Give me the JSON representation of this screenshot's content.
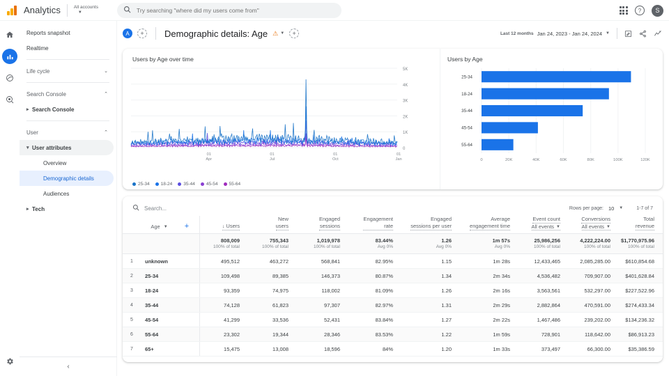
{
  "topbar": {
    "brand": "Analytics",
    "account_label": "All accounts",
    "search_placeholder": "Try searching \"where did my users come from\"",
    "search_value": "",
    "avatar_initial": "S"
  },
  "rail": {
    "items": [
      {
        "name": "home-icon",
        "label": "Home"
      },
      {
        "name": "reports-icon",
        "label": "Reports"
      },
      {
        "name": "explore-icon",
        "label": "Explore"
      },
      {
        "name": "advertising-icon",
        "label": "Advertising"
      }
    ],
    "settings_label": "Admin"
  },
  "sidebar": {
    "items": [
      {
        "label": "Reports snapshot",
        "type": "plain"
      },
      {
        "label": "Realtime",
        "type": "plain"
      },
      {
        "label": "Life cycle",
        "type": "group",
        "chevron": "⌄"
      },
      {
        "label": "Search Console",
        "type": "group",
        "chevron": "⌃"
      },
      {
        "label": "Search Console",
        "type": "sub"
      },
      {
        "label": "User",
        "type": "group",
        "chevron": "⌃"
      },
      {
        "label": "User attributes",
        "type": "sub-active"
      },
      {
        "label": "Overview",
        "type": "leaf"
      },
      {
        "label": "Demographic details",
        "type": "leaf-selected"
      },
      {
        "label": "Audiences",
        "type": "leaf"
      },
      {
        "label": "Tech",
        "type": "sub"
      }
    ],
    "collapse_label": "‹"
  },
  "header": {
    "chip_initial": "A",
    "add_comparison_label": "+",
    "title": "Demographic details: Age",
    "warning_label": "⚠",
    "add_label": "+",
    "date_preset": "Last 12 months",
    "date_range": "Jan 24, 2023 - Jan 24, 2024",
    "actions": [
      "edit-icon",
      "share-icon",
      "insights-icon"
    ]
  },
  "chart_data": [
    {
      "type": "line",
      "title": "Users by Age over time",
      "xlabel": "",
      "ylabel": "",
      "ylim": [
        0,
        5000
      ],
      "yticks": [
        "0",
        "1K",
        "2K",
        "3K",
        "4K",
        "5K"
      ],
      "xticks": [
        {
          "top": "01",
          "bottom": "Apr"
        },
        {
          "top": "01",
          "bottom": "Jul"
        },
        {
          "top": "01",
          "bottom": "Oct"
        },
        {
          "top": "01",
          "bottom": "Jan"
        }
      ],
      "grid": true,
      "legend_position": "bottom",
      "series": [
        {
          "name": "25-34",
          "color": "#1a73c8",
          "peak": 4300,
          "base": 420
        },
        {
          "name": "18-24",
          "color": "#1a73e8",
          "peak": 2600,
          "base": 330
        },
        {
          "name": "35-44",
          "color": "#5b4ee0",
          "peak": 1700,
          "base": 250
        },
        {
          "name": "45-54",
          "color": "#8a3fd1",
          "peak": 900,
          "base": 150
        },
        {
          "name": "55-64",
          "color": "#a02bbd",
          "peak": 600,
          "base": 90
        }
      ]
    },
    {
      "type": "bar",
      "title": "Users by Age",
      "orientation": "horizontal",
      "categories": [
        "25-34",
        "18-24",
        "35-44",
        "45-54",
        "55-64"
      ],
      "values": [
        109498,
        93359,
        74128,
        41299,
        23302
      ],
      "xticks": [
        "0",
        "20K",
        "40K",
        "60K",
        "80K",
        "100K",
        "120K"
      ],
      "xlim": [
        0,
        120000
      ],
      "bar_color": "#1a73e8",
      "grid": true
    }
  ],
  "table": {
    "search_placeholder": "Search...",
    "search_value": "",
    "rows_per_page_label": "Rows per page:",
    "rows_per_page_value": "10",
    "pagination": "1-7 of 7",
    "dimension_header": "Age",
    "add_dimension_label": "+",
    "columns": [
      {
        "label": "Users",
        "sorted": true,
        "sub": ""
      },
      {
        "label": "New\nusers",
        "sub": ""
      },
      {
        "label": "Engaged\nsessions",
        "sub": ""
      },
      {
        "label": "Engagement\nrate",
        "sub": ""
      },
      {
        "label": "Engaged\nsessions per user",
        "sub": ""
      },
      {
        "label": "Average\nengagement time",
        "sub": ""
      },
      {
        "label": "Event count",
        "sub": "All events"
      },
      {
        "label": "Conversions",
        "sub": "All events"
      },
      {
        "label": "Total\nrevenue",
        "sub": ""
      }
    ],
    "totals": [
      {
        "value": "808,009",
        "unit": "100% of total"
      },
      {
        "value": "755,343",
        "unit": "100% of total"
      },
      {
        "value": "1,019,978",
        "unit": "100% of total"
      },
      {
        "value": "83.44%",
        "unit": "Avg 0%"
      },
      {
        "value": "1.26",
        "unit": "Avg 0%"
      },
      {
        "value": "1m 57s",
        "unit": "Avg 0%"
      },
      {
        "value": "25,986,256",
        "unit": "100% of total"
      },
      {
        "value": "4,222,224.00",
        "unit": "100% of total"
      },
      {
        "value": "$1,770,975.96",
        "unit": "100% of total"
      }
    ],
    "rows": [
      {
        "idx": "1",
        "dim": "unknown",
        "cells": [
          "495,512",
          "463,272",
          "568,841",
          "82.95%",
          "1.15",
          "1m 28s",
          "12,433,465",
          "2,085,285.00",
          "$610,854.68"
        ]
      },
      {
        "idx": "2",
        "dim": "25-34",
        "cells": [
          "109,498",
          "89,385",
          "146,373",
          "80.87%",
          "1.34",
          "2m 34s",
          "4,536,482",
          "709,907.00",
          "$401,628.84"
        ]
      },
      {
        "idx": "3",
        "dim": "18-24",
        "cells": [
          "93,359",
          "74,975",
          "118,002",
          "81.09%",
          "1.26",
          "2m 16s",
          "3,563,561",
          "532,297.00",
          "$227,522.96"
        ]
      },
      {
        "idx": "4",
        "dim": "35-44",
        "cells": [
          "74,128",
          "61,823",
          "97,307",
          "82.97%",
          "1.31",
          "2m 29s",
          "2,882,864",
          "470,591.00",
          "$274,433.34"
        ]
      },
      {
        "idx": "5",
        "dim": "45-54",
        "cells": [
          "41,299",
          "33,536",
          "52,431",
          "83.84%",
          "1.27",
          "2m 22s",
          "1,467,486",
          "239,202.00",
          "$134,236.32"
        ]
      },
      {
        "idx": "6",
        "dim": "55-64",
        "cells": [
          "23,302",
          "19,344",
          "28,346",
          "83.53%",
          "1.22",
          "1m 59s",
          "728,901",
          "118,642.00",
          "$86,913.23"
        ]
      },
      {
        "idx": "7",
        "dim": "65+",
        "cells": [
          "15,475",
          "13,008",
          "18,596",
          "84%",
          "1.20",
          "1m 33s",
          "373,497",
          "66,300.00",
          "$35,386.59"
        ]
      }
    ]
  },
  "colors": {
    "accent": "#1a73e8",
    "selected_bg": "#e8f0fe",
    "warning": "#e8710a"
  }
}
